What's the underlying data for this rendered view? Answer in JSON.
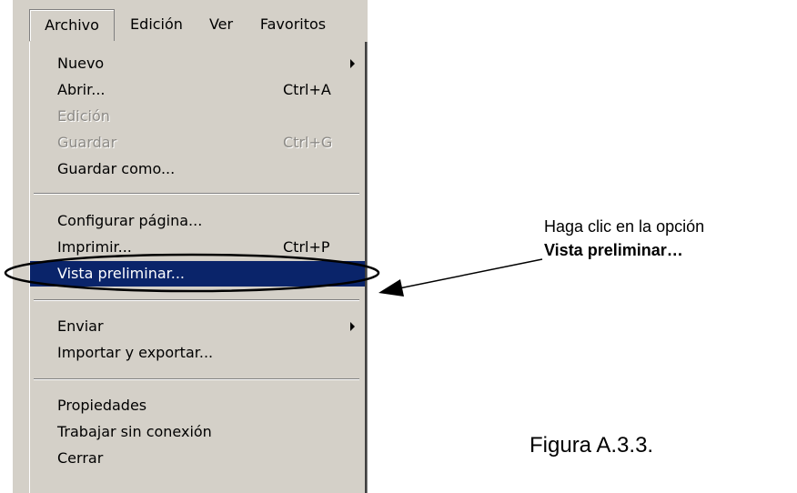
{
  "menubar": {
    "items": [
      {
        "label": "Archivo"
      },
      {
        "label": "Edición"
      },
      {
        "label": "Ver"
      },
      {
        "label": "Favoritos"
      }
    ]
  },
  "menu": {
    "items": [
      {
        "label": "Nuevo",
        "shortcut": "",
        "submenu": true,
        "enabled": true
      },
      {
        "label": "Abrir...",
        "shortcut": "Ctrl+A",
        "submenu": false,
        "enabled": true
      },
      {
        "label": "Edición",
        "shortcut": "",
        "submenu": false,
        "enabled": false
      },
      {
        "label": "Guardar",
        "shortcut": "Ctrl+G",
        "submenu": false,
        "enabled": false
      },
      {
        "label": "Guardar como...",
        "shortcut": "",
        "submenu": false,
        "enabled": true
      },
      {
        "label": "Configurar página...",
        "shortcut": "",
        "submenu": false,
        "enabled": true
      },
      {
        "label": "Imprimir...",
        "shortcut": "Ctrl+P",
        "submenu": false,
        "enabled": true
      },
      {
        "label": "Vista preliminar...",
        "shortcut": "",
        "submenu": false,
        "enabled": true,
        "selected": true
      },
      {
        "label": "Enviar",
        "shortcut": "",
        "submenu": true,
        "enabled": true
      },
      {
        "label": "Importar y exportar...",
        "shortcut": "",
        "submenu": false,
        "enabled": true
      },
      {
        "label": "Propiedades",
        "shortcut": "",
        "submenu": false,
        "enabled": true
      },
      {
        "label": "Trabajar sin conexión",
        "shortcut": "",
        "submenu": false,
        "enabled": true
      },
      {
        "label": "Cerrar",
        "shortcut": "",
        "submenu": false,
        "enabled": true
      }
    ]
  },
  "annotation": {
    "line1": "Haga clic en la opción",
    "line2": "Vista preliminar…"
  },
  "caption": "Figura A.3.3.",
  "colors": {
    "menu_bg": "#d4d0c8",
    "selection_bg": "#0a246a",
    "disabled_text": "#8c8a86"
  }
}
